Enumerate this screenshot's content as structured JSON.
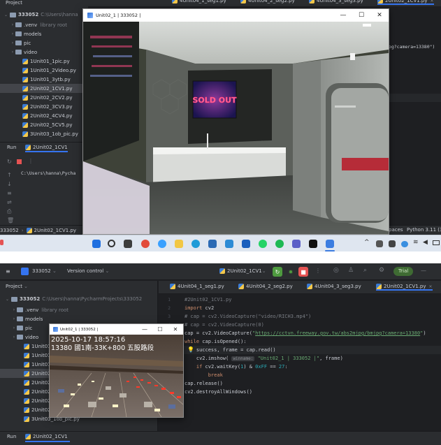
{
  "top": {
    "project_label": "Project",
    "root_name": "333052",
    "root_path": "C:\\Users\\hanna",
    "tree": [
      {
        "label": ".venv",
        "suffix": "library root",
        "kind": "folder",
        "indent": 1,
        "chev": "›"
      },
      {
        "label": "models",
        "kind": "folder",
        "indent": 1,
        "chev": "›"
      },
      {
        "label": "pic",
        "kind": "folder",
        "indent": 1,
        "chev": "›"
      },
      {
        "label": "video",
        "kind": "folder",
        "indent": 1,
        "chev": "›"
      },
      {
        "label": "1Unit01_1pic.py",
        "kind": "py",
        "indent": 2
      },
      {
        "label": "1Unit01_2Video.py",
        "kind": "py",
        "indent": 2
      },
      {
        "label": "1Unit01_3ytb.py",
        "kind": "py",
        "indent": 2
      },
      {
        "label": "2Unit02_1CV1.py",
        "kind": "py",
        "indent": 2,
        "selected": true
      },
      {
        "label": "2Unit02_2CV2.py",
        "kind": "py",
        "indent": 2
      },
      {
        "label": "2Unit02_3CV3.py",
        "kind": "py",
        "indent": 2
      },
      {
        "label": "2Unit02_4CV4.py",
        "kind": "py",
        "indent": 2
      },
      {
        "label": "2Unit02_5CV5.py",
        "kind": "py",
        "indent": 2
      },
      {
        "label": "3Unit03_1ob_pic.py",
        "kind": "py",
        "indent": 2
      }
    ],
    "tabs": [
      "4Unit04_1_seg1.py",
      "4Unit04_2_seg2.py",
      "4Unit04_3_seg3.py",
      "2Unit02_1CV1.py"
    ],
    "url_fragment": "jpg?camera=13380\")",
    "run_label": "Run",
    "run_tab": "2Unit02_1CV1",
    "console_path": "C:\\Users\\hanna\\Pycha",
    "status_left": "333052",
    "status_file": "2Unit02_1CV1.py",
    "status_right_1": "paces",
    "status_right_2": "Python 3.11 (3",
    "capture_title": "Unit02_1 | 333052 |",
    "neon_sign": "SOLD OUT"
  },
  "bottom": {
    "project_badge": "333052",
    "version_control": "Version control",
    "run_config": "2Unit02_1CV1",
    "trial": "Trial",
    "project_label": "Project",
    "root_name": "333052",
    "root_path": "C:\\Users\\hanna\\PycharmProjects\\333052",
    "tree": [
      {
        "label": ".venv",
        "suffix": "library root",
        "kind": "folder",
        "indent": 1,
        "chev": "›"
      },
      {
        "label": "models",
        "kind": "folder",
        "indent": 1,
        "chev": "›"
      },
      {
        "label": "pic",
        "kind": "folder",
        "indent": 1,
        "chev": "›"
      },
      {
        "label": "video",
        "kind": "folder",
        "indent": 1,
        "chev": "›"
      },
      {
        "label": "1Unit01_1pic.py",
        "kind": "py",
        "indent": 2
      },
      {
        "label": "1Unit01_2Video.py",
        "kind": "py",
        "indent": 2
      },
      {
        "label": "1Unit01_3ytb.py",
        "kind": "py",
        "indent": 2
      },
      {
        "label": "2Unit02_1CV1.py",
        "kind": "py",
        "indent": 2,
        "selected": true
      },
      {
        "label": "2Unit02_2CV2.py",
        "kind": "py",
        "indent": 2
      },
      {
        "label": "2Unit02_3CV3.py",
        "kind": "py",
        "indent": 2
      },
      {
        "label": "2Unit02_4CV4.py",
        "kind": "py",
        "indent": 2
      },
      {
        "label": "2Unit02_5CV5.py",
        "kind": "py",
        "indent": 2
      },
      {
        "label": "3Unit03_1ob_pic.py",
        "kind": "py",
        "indent": 2
      }
    ],
    "tabs": [
      "4Unit04_1_seg1.py",
      "4Unit04_2_seg2.py",
      "4Unit04_3_seg3.py",
      "2Unit02_1CV1.py"
    ],
    "code": [
      {
        "n": "1",
        "html": "<span class='cm'>#2Unit02_1CV1.py</span>"
      },
      {
        "n": "2",
        "html": "<span class='kw'>import</span> cv2"
      },
      {
        "n": "3",
        "html": "<span class='cm'># cap = cv2.VideoCapture(\"video/RICH3.mp4\")</span>"
      },
      {
        "n": "4",
        "html": "<span class='cm'># cap = cv2.VideoCapture(0)</span>"
      },
      {
        "n": "5",
        "html": "cap = cv2.VideoCapture(<span class='str'>\"</span><span class='lnk'>https://cctvn.freeway.gov.tw/abs2mjpg/bmjpg?camera=13380</span><span class='str'>\"</span>)"
      },
      {
        "n": "6",
        "html": "<span class='kw'>while</span> cap.isOpened():"
      },
      {
        "n": "7",
        "html": "    success, frame = cap.read()"
      },
      {
        "n": "8",
        "html": "    cv2.imshow( <span class='hint'>winname:</span> <span class='str'>\"Unit02_1 | 333052 |\"</span>, frame)"
      },
      {
        "n": "9",
        "html": "    <span class='kw'>if</span> cv2.waitKey(<span class='num'>1</span>) &amp; <span class='num'>0xFF</span> == <span class='num'>27</span>:"
      },
      {
        "n": "10",
        "html": "        <span class='kw'>break</span>"
      },
      {
        "n": "11",
        "html": "cap.release()"
      },
      {
        "n": "12",
        "html": "cv2.destroyAllWindows()"
      }
    ],
    "capture_title": "Unit02_1 | 333052 |",
    "overlay_line1": "2025-10-17 18:57:16",
    "overlay_line2": "13380 國1南-33K+800 五股路段",
    "run_label": "Run",
    "run_tab": "2Unit02_1CV1"
  },
  "colors": {
    "ide_bg": "#1e1f22",
    "panel": "#2b2d30",
    "accent": "#3574f0",
    "trial": "#4e9a3f",
    "stop": "#e55353"
  }
}
